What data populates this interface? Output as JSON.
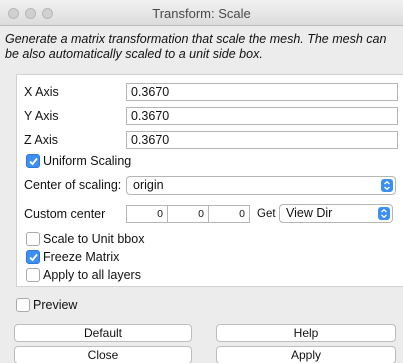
{
  "window": {
    "title": "Transform: Scale"
  },
  "description": "Generate a matrix transformation that scale the mesh. The mesh can be also automatically scaled to a unit side box.",
  "axes": [
    {
      "label": "X Axis",
      "value": "0.3670"
    },
    {
      "label": "Y Axis",
      "value": "0.3670"
    },
    {
      "label": "Z Axis",
      "value": "0.3670"
    }
  ],
  "uniform_scaling": {
    "label": "Uniform Scaling",
    "checked": true
  },
  "center_of_scaling": {
    "label": "Center of scaling:",
    "value": "origin"
  },
  "custom_center": {
    "label": "Custom center",
    "values": [
      "0",
      "0",
      "0"
    ],
    "get_label": "Get",
    "view_dir": "View Dir"
  },
  "options": [
    {
      "label": "Scale to Unit bbox",
      "checked": false
    },
    {
      "label": "Freeze Matrix",
      "checked": true
    },
    {
      "label": "Apply to all layers",
      "checked": false
    }
  ],
  "preview": {
    "label": "Preview",
    "checked": false
  },
  "buttons": {
    "default": "Default",
    "help": "Help",
    "close": "Close",
    "apply": "Apply"
  },
  "colors": {
    "accent": "#3d8ff2",
    "panel_bg": "#ffffff",
    "window_bg": "#ececec"
  }
}
